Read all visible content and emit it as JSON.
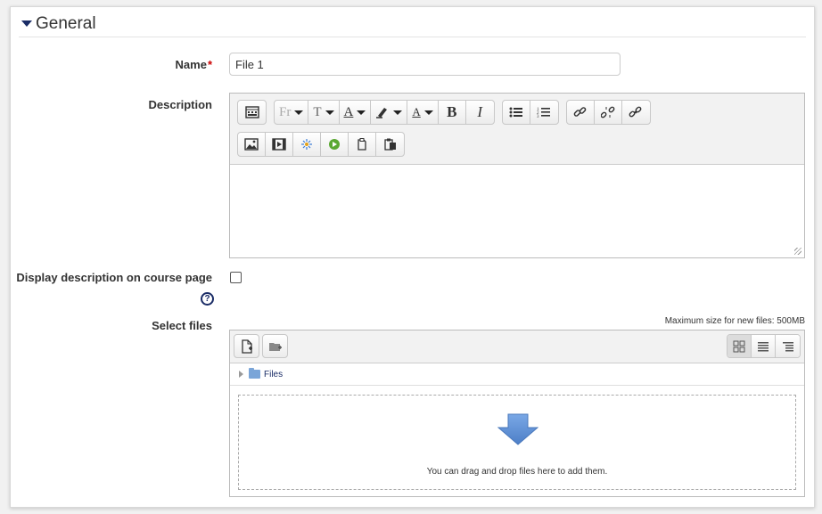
{
  "section": {
    "title": "General"
  },
  "fields": {
    "name": {
      "label": "Name",
      "required_mark": "*",
      "value": "File 1"
    },
    "description": {
      "label": "Description"
    },
    "display_description": {
      "label": "Display description on course page",
      "checked": false
    },
    "select_files": {
      "label": "Select files",
      "max_size": "Maximum size for new files: 500MB"
    }
  },
  "editor": {
    "toolbar_row1": [
      {
        "name": "toolbar-toggle-icon"
      },
      {
        "name": "font-family-icon",
        "text": "Fr",
        "dropdown": true
      },
      {
        "name": "font-size-icon",
        "text": "T",
        "dropdown": true
      },
      {
        "name": "font-color-icon",
        "text": "A",
        "dropdown": true
      },
      {
        "name": "highlight-icon",
        "dropdown": true
      },
      {
        "name": "text-style-icon",
        "text": "A",
        "dropdown": true
      },
      {
        "name": "bold-icon",
        "text": "B"
      },
      {
        "name": "italic-icon",
        "text": "I"
      },
      {
        "name": "unordered-list-icon"
      },
      {
        "name": "ordered-list-icon"
      },
      {
        "name": "link-icon"
      },
      {
        "name": "unlink-icon"
      },
      {
        "name": "anchor-link-icon"
      }
    ],
    "toolbar_row2": [
      {
        "name": "image-icon"
      },
      {
        "name": "media-icon"
      },
      {
        "name": "h5p-icon"
      },
      {
        "name": "record-video-icon"
      },
      {
        "name": "copy-icon"
      },
      {
        "name": "paste-icon"
      }
    ]
  },
  "filemanager": {
    "path_label": "Files",
    "drop_text": "You can drag and drop files here to add them.",
    "accent_color": "#5b8fd6"
  }
}
